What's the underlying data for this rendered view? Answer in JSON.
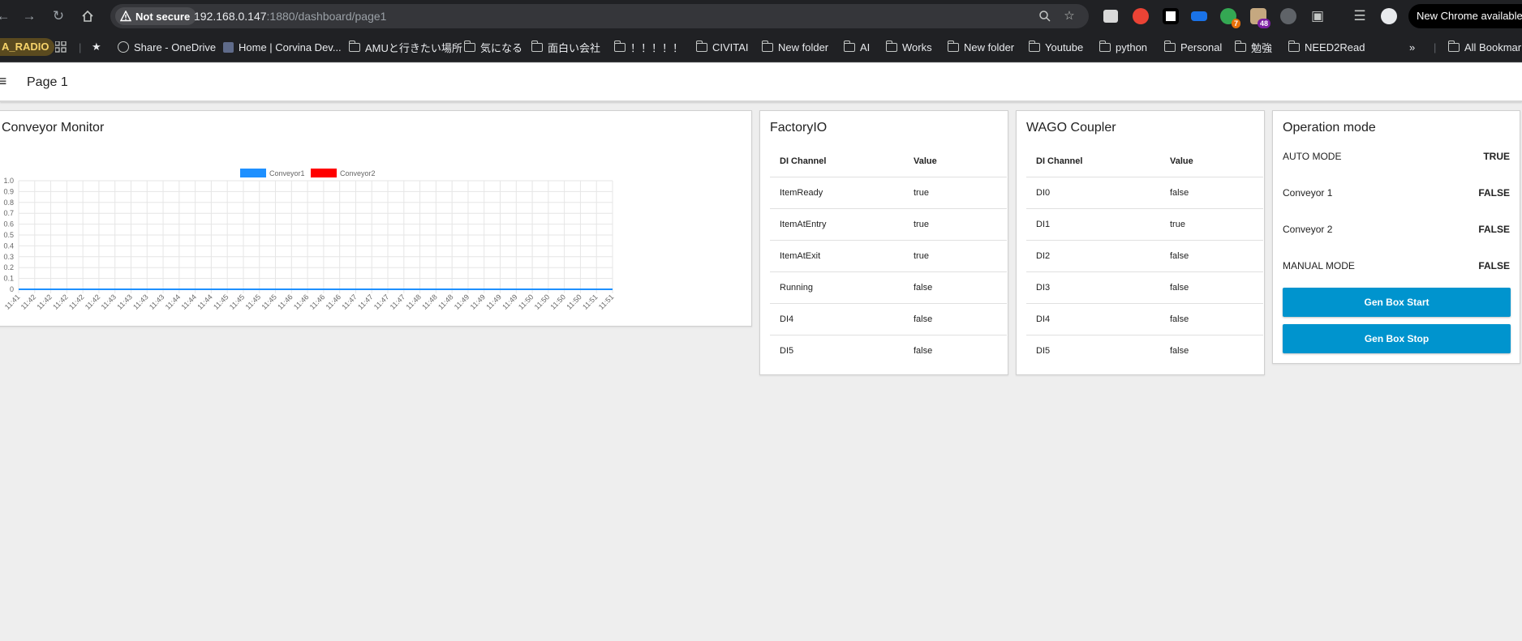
{
  "browser": {
    "security_label": "Not secure",
    "url_host": "192.168.0.147",
    "url_path": ":1880/dashboard/page1",
    "update_label": "New Chrome available",
    "extensions": [
      {
        "icon": "extension-icon",
        "color": "#d9d9d9"
      },
      {
        "icon": "extension-icon",
        "color": "#ea4335"
      },
      {
        "icon": "extension-icon",
        "color": "#ffffff"
      },
      {
        "icon": "extension-icon",
        "color": "#1a73e8"
      },
      {
        "icon": "extension-icon",
        "color": "#34a853",
        "badge": "7",
        "badge_color": "#e8710a"
      },
      {
        "icon": "extension-icon",
        "color": "#c5a880",
        "badge": "48",
        "badge_color": "#7b1fa2"
      },
      {
        "icon": "extension-icon",
        "color": "#5f6368"
      }
    ]
  },
  "bookmarks": {
    "radio": "A_RADIO",
    "items": [
      {
        "label": "Share - OneDrive",
        "icon": "globe-icon"
      },
      {
        "label": "Home | Corvina Dev...",
        "icon": "site-icon"
      },
      {
        "label": "AMUと行きたい場所",
        "icon": "folder-icon"
      },
      {
        "label": "気になる",
        "icon": "folder-icon"
      },
      {
        "label": "面白い会社",
        "icon": "folder-icon"
      },
      {
        "label": "！！！！！",
        "icon": "folder-icon"
      },
      {
        "label": "CIVITAI",
        "icon": "folder-icon"
      },
      {
        "label": "New folder",
        "icon": "folder-icon"
      },
      {
        "label": "AI",
        "icon": "folder-icon"
      },
      {
        "label": "Works",
        "icon": "folder-icon"
      },
      {
        "label": "New folder",
        "icon": "folder-icon"
      },
      {
        "label": "Youtube",
        "icon": "folder-icon"
      },
      {
        "label": "python",
        "icon": "folder-icon"
      },
      {
        "label": "Personal",
        "icon": "folder-icon"
      },
      {
        "label": "勉強",
        "icon": "folder-icon"
      },
      {
        "label": "NEED2Read",
        "icon": "folder-icon"
      }
    ],
    "all_label": "All Bookmarks"
  },
  "dashboard": {
    "page_title": "Page 1",
    "conveyor_monitor": {
      "title": "Conveyor Monitor"
    },
    "factoryio": {
      "title": "FactoryIO",
      "col_channel": "DI Channel",
      "col_value": "Value",
      "rows": [
        {
          "channel": "ItemReady",
          "value": "true"
        },
        {
          "channel": "ItemAtEntry",
          "value": "true"
        },
        {
          "channel": "ItemAtExit",
          "value": "true"
        },
        {
          "channel": "Running",
          "value": "false"
        },
        {
          "channel": "DI4",
          "value": "false"
        },
        {
          "channel": "DI5",
          "value": "false"
        }
      ]
    },
    "wago": {
      "title": "WAGO Coupler",
      "col_channel": "DI Channel",
      "col_value": "Value",
      "rows": [
        {
          "channel": "DI0",
          "value": "false"
        },
        {
          "channel": "DI1",
          "value": "true"
        },
        {
          "channel": "DI2",
          "value": "false"
        },
        {
          "channel": "DI3",
          "value": "false"
        },
        {
          "channel": "DI4",
          "value": "false"
        },
        {
          "channel": "DI5",
          "value": "false"
        }
      ]
    },
    "operation": {
      "title": "Operation mode",
      "rows": [
        {
          "label": "AUTO MODE",
          "value": "TRUE"
        },
        {
          "label": "Conveyor 1",
          "value": "FALSE"
        },
        {
          "label": "Conveyor 2",
          "value": "FALSE"
        },
        {
          "label": "MANUAL MODE",
          "value": "FALSE"
        }
      ],
      "start_label": "Gen Box Start",
      "stop_label": "Gen Box Stop",
      "button_color": "#0094ce"
    }
  },
  "chart_data": {
    "type": "line",
    "title": "",
    "xlabel": "",
    "ylabel": "",
    "ylim": [
      0,
      1
    ],
    "yticks": [
      "0",
      "0.1",
      "0.2",
      "0.3",
      "0.4",
      "0.5",
      "0.6",
      "0.7",
      "0.8",
      "0.9",
      "1.0"
    ],
    "x": [
      "11:41",
      "11:42",
      "11:42",
      "11:42",
      "11:42",
      "11:42",
      "11:43",
      "11:43",
      "11:43",
      "11:43",
      "11:44",
      "11:44",
      "11:44",
      "11:45",
      "11:45",
      "11:45",
      "11:45",
      "11:46",
      "11:46",
      "11:46",
      "11:46",
      "11:47",
      "11:47",
      "11:47",
      "11:47",
      "11:48",
      "11:48",
      "11:48",
      "11:49",
      "11:49",
      "11:49",
      "11:49",
      "11:50",
      "11:50",
      "11:50",
      "11:50",
      "11:51",
      "11:51"
    ],
    "series": [
      {
        "name": "Conveyor1",
        "color": "#1e90ff",
        "values": [
          0,
          0,
          0,
          0,
          0,
          0,
          0,
          0,
          0,
          0,
          0,
          0,
          0,
          0,
          0,
          0,
          0,
          0,
          0,
          0,
          0,
          0,
          0,
          0,
          0,
          0,
          0,
          0,
          0,
          0,
          0,
          0,
          0,
          0,
          0,
          0,
          0,
          0
        ]
      },
      {
        "name": "Conveyor2",
        "color": "#ff0000",
        "values": [
          0,
          0,
          0,
          0,
          0,
          0,
          0,
          0,
          0,
          0,
          0,
          0,
          0,
          0,
          0,
          0,
          0,
          0,
          0,
          0,
          0,
          0,
          0,
          0,
          0,
          0,
          0,
          0,
          0,
          0,
          0,
          0,
          0,
          0,
          0,
          0,
          0,
          0
        ]
      }
    ],
    "grid": true,
    "legend": "top-center"
  }
}
